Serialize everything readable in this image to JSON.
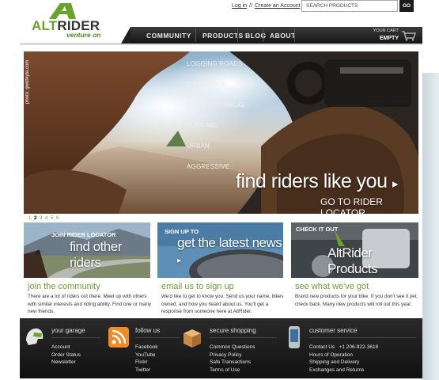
{
  "logo": {
    "brand_alt": "ALT",
    "brand_rider": "RIDER",
    "tagline": "venture on"
  },
  "header": {
    "login": "Log in",
    "separator": "//",
    "create_account": "Create an Account",
    "search_placeholder": "SEARCH PRODUCTS",
    "go_label": "GO",
    "cart_label": "YOUR CART",
    "cart_status": "EMPTY",
    "cart_icon": "cart-icon"
  },
  "nav": {
    "items": [
      "COMMUNITY",
      "PRODUCTS",
      "BLOG",
      "ABOUT"
    ]
  },
  "hero": {
    "credit": "photo: gwdfeyte.com",
    "terrains": [
      "LOGGING ROADS",
      "TWO TRACK",
      "TIGHT TECHNICAL",
      "TOURING",
      "URBAN",
      "AGGRESSIVE"
    ],
    "title": "find riders like you",
    "cta": "GO TO RIDER LOCATOR",
    "arrow": "▸",
    "pager": [
      "1",
      "2",
      "3",
      "4",
      "5",
      "6"
    ],
    "current_page": "2"
  },
  "cards": [
    {
      "pre": "JOIN RIDER LOCATOR",
      "big": "find other riders",
      "heading": "join the community",
      "body": "There are a lot of riders out there. Meet up with others with similar interests and riding ability. Find one or many new friends."
    },
    {
      "pre": "SIGN UP TO",
      "big": "get the latest news",
      "heading": "email us to sign up",
      "body": "We'd like to get to know you. Send us your name, bikes owned, and how you heard about us. You'll get a response from someone here at AltRider."
    },
    {
      "pre": "CHECK IT OUT",
      "big": "AltRider Products",
      "heading": "see what we've got",
      "body": "Brand new products for your bike. If you don't see it yet, check back. Many new products will roll out this year."
    }
  ],
  "footer": {
    "columns": [
      {
        "heading": "your garage",
        "icon": "helmet-icon",
        "links": [
          "Account",
          "Order Status",
          "Newsletter"
        ]
      },
      {
        "heading": "follow us",
        "icon": "rss-icon",
        "links": [
          "Facebook",
          "YouTube",
          "Flickr",
          "Twitter"
        ]
      },
      {
        "heading": "secure shopping",
        "icon": "package-icon",
        "links": [
          "Common Questions",
          "Privacy Policy",
          "Safe Transactions",
          "Terms of Use"
        ]
      },
      {
        "heading": "customer service",
        "icon": "phone-icon",
        "links": [
          "Contact Us",
          "Hours of Operation",
          "Shipping and Delivery",
          "Exchanges and Returns"
        ],
        "phone": "+1 206-922-3618"
      }
    ]
  },
  "colors": {
    "accent": "#6aa22c",
    "nav_bg": "#1b1b1b",
    "footer_bg": "#1c1c1c"
  }
}
